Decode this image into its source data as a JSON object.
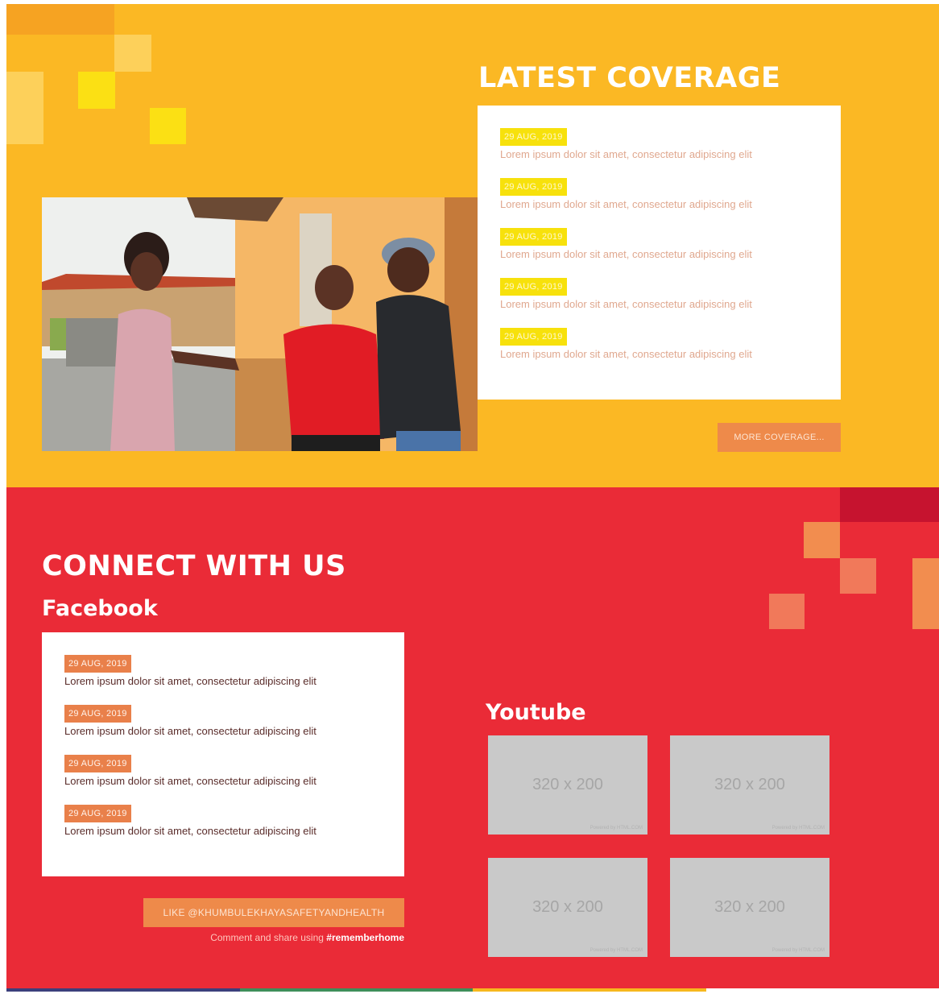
{
  "coverage": {
    "title": "LATEST COVERAGE",
    "items": [
      {
        "date": "29 AUG, 2019",
        "text": "Lorem ipsum dolor sit amet, consectetur adipiscing elit"
      },
      {
        "date": "29 AUG, 2019",
        "text": "Lorem ipsum dolor sit amet, consectetur adipiscing elit"
      },
      {
        "date": "29 AUG, 2019",
        "text": "Lorem ipsum dolor sit amet, consectetur adipiscing elit"
      },
      {
        "date": "29 AUG, 2019",
        "text": "Lorem ipsum dolor sit amet, consectetur adipiscing elit"
      },
      {
        "date": "29 AUG, 2019",
        "text": "Lorem ipsum dolor sit amet, consectetur adipiscing elit"
      }
    ],
    "more_label": "MORE COVERAGE..."
  },
  "connect": {
    "title": "CONNECT WITH US",
    "facebook": {
      "title": "Facebook",
      "posts": [
        {
          "date": "29 AUG, 2019",
          "text": "Lorem ipsum dolor sit amet, consectetur adipiscing elit"
        },
        {
          "date": "29 AUG, 2019",
          "text": "Lorem ipsum dolor sit amet, consectetur adipiscing elit"
        },
        {
          "date": "29 AUG, 2019",
          "text": "Lorem ipsum dolor sit amet, consectetur adipiscing elit"
        },
        {
          "date": "29 AUG, 2019",
          "text": "Lorem ipsum dolor sit amet, consectetur adipiscing elit"
        }
      ],
      "like_label": "LIKE @KHUMBULEKHAYASAFETYANDHEALTH",
      "share_prefix": "Comment and share using ",
      "share_tag": "#rememberhome"
    },
    "youtube": {
      "title": "Youtube",
      "thumbs": [
        {
          "label": "320 x 200",
          "credit": "Powered by HTML.COM"
        },
        {
          "label": "320 x 200",
          "credit": "Powered by HTML.COM"
        },
        {
          "label": "320 x 200",
          "credit": "Powered by HTML.COM"
        },
        {
          "label": "320 x 200",
          "credit": "Powered by HTML.COM"
        }
      ]
    }
  },
  "colors": {
    "yellow_bg": "#fbb824",
    "red_bg": "#ea2b37",
    "orange_button": "#ee8a4a",
    "yellow_badge": "#f7e10c",
    "orange_badge": "#e9804a"
  },
  "icons": [
    "decorative-squares",
    "photo"
  ]
}
